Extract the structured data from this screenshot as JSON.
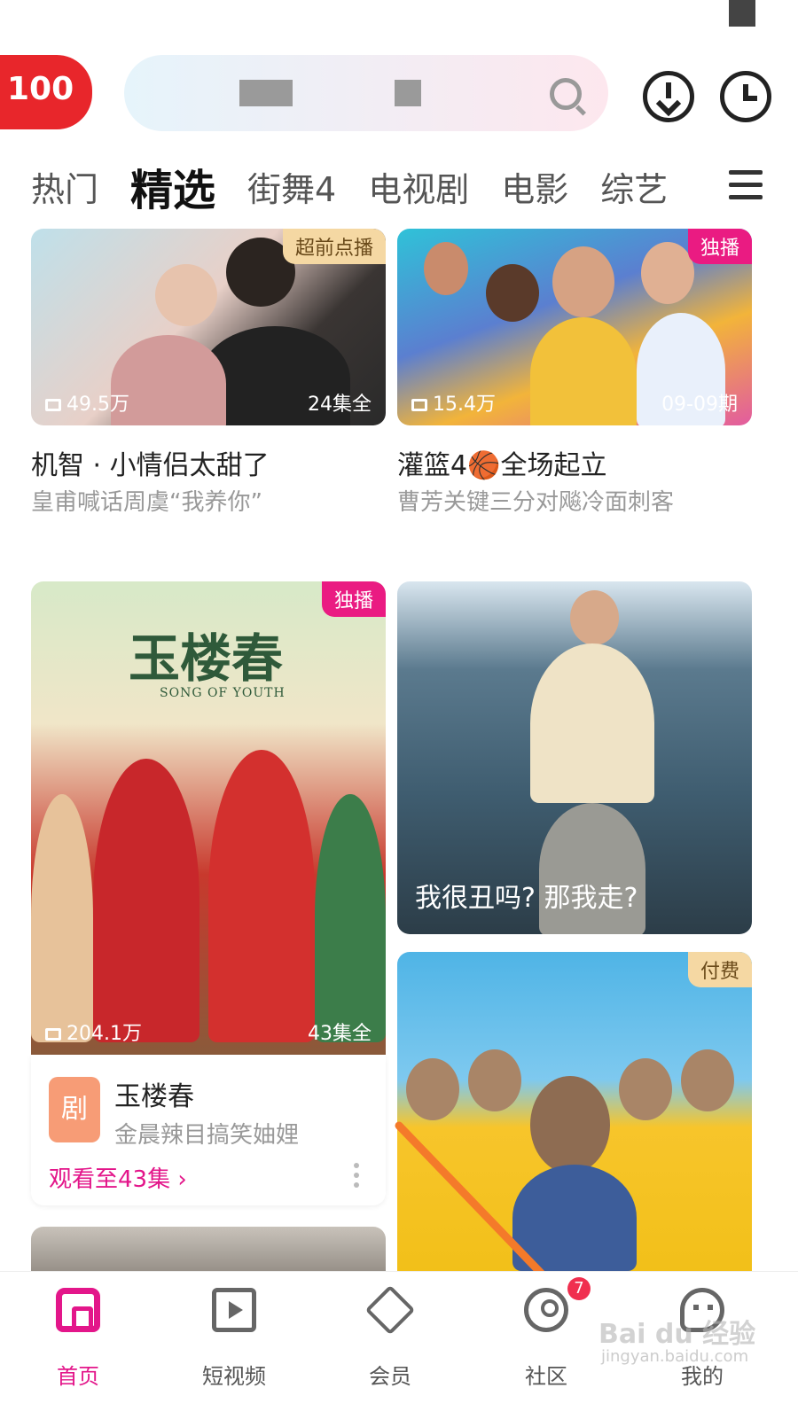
{
  "header": {
    "logo_text": "100",
    "icons": [
      "search-icon",
      "download-icon",
      "history-icon",
      "menu-icon"
    ]
  },
  "tabs": [
    {
      "label": "热门",
      "active": false
    },
    {
      "label": "精选",
      "active": true
    },
    {
      "label": "街舞4",
      "active": false
    },
    {
      "label": "电视剧",
      "active": false
    },
    {
      "label": "电影",
      "active": false
    },
    {
      "label": "综艺",
      "active": false
    }
  ],
  "cards": {
    "c1": {
      "badge": "超前点播",
      "views": "49.5万",
      "episodes": "24集全",
      "title": "机智 · 小情侣太甜了",
      "subtitle": "皇甫喊话周虞“我养你”"
    },
    "c2": {
      "badge": "独播",
      "views": "15.4万",
      "episodes": "09-09期",
      "title": "灌篮4🏀全场起立",
      "subtitle": "曹芳关键三分对飚冷面刺客"
    },
    "c3": {
      "badge": "独播",
      "views": "204.1万",
      "episodes": "43集全",
      "poster_title": "玉楼春",
      "poster_sub": "SONG OF YOUTH"
    },
    "c4": {
      "caption": "我很丑吗? 那我走?"
    },
    "c5": {
      "badge": "付费"
    }
  },
  "info_panel": {
    "icon_text": "剧",
    "title": "玉楼春",
    "subtitle": "金晨辣目搞笑妯娌",
    "link": "观看至43集 ›"
  },
  "bottom_nav": [
    {
      "label": "首页",
      "active": true
    },
    {
      "label": "短视频",
      "active": false
    },
    {
      "label": "会员",
      "active": false
    },
    {
      "label": "社区",
      "active": false,
      "badge": "7"
    },
    {
      "label": "我的",
      "active": false
    }
  ],
  "watermark": {
    "line1": "Bai du 经验",
    "line2": "jingyan.baidu.com"
  },
  "colors": {
    "accent": "#e3168a",
    "badge_pink": "#ea1b82",
    "badge_gold": "#f5d8a3",
    "arrow": "#f47a2a"
  }
}
